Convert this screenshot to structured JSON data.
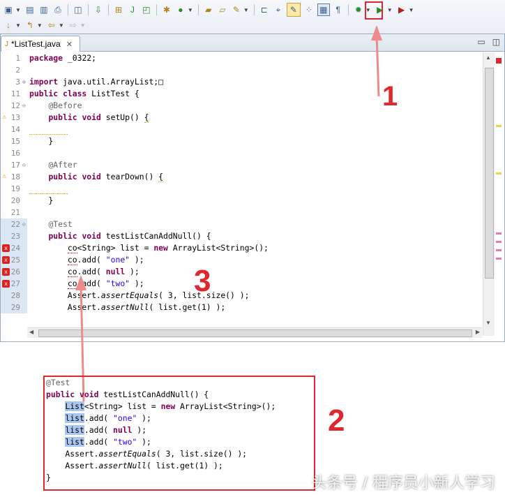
{
  "toolbar": {
    "row1_icons": [
      "new-icon",
      "save-icon",
      "save-all-icon",
      "print-icon",
      "binary-icon",
      "debug-step-icon",
      "new-package-icon",
      "new-junit-icon",
      "new-class-icon",
      "build-icon",
      "run-icon",
      "open-folder-icon",
      "open-type-icon",
      "pen-icon",
      "back-icon",
      "next-annotation-icon",
      "toggle-mark-occurrences-icon",
      "toggle-breadcrumb-icon",
      "block-selection-mode-icon",
      "show-whitespace-icon",
      "debug-run-icon",
      "run-play-icon",
      "external-tools-icon"
    ],
    "row2_icons": [
      "next-edit-icon",
      "prev-edit-icon",
      "back-arrow-icon",
      "forward-arrow-icon"
    ]
  },
  "tab": {
    "label": "*ListTest.java"
  },
  "editor": {
    "lines": [
      {
        "num": "1",
        "text": [
          {
            "t": "package",
            "c": "kw"
          },
          {
            "t": " _0322;",
            "c": ""
          }
        ]
      },
      {
        "num": "2",
        "text": []
      },
      {
        "num": "3",
        "text": [
          {
            "t": "import",
            "c": "kw"
          },
          {
            "t": " java.util.ArrayList;",
            "c": ""
          },
          {
            "t": "□",
            "c": ""
          }
        ]
      },
      {
        "num": "11",
        "text": [
          {
            "t": "public class",
            "c": "kw"
          },
          {
            "t": " ListTest {",
            "c": ""
          }
        ]
      },
      {
        "num": "12",
        "text": [
          {
            "t": "    ",
            "c": ""
          },
          {
            "t": "@Before",
            "c": "ann"
          }
        ]
      },
      {
        "num": "13",
        "text": [
          {
            "t": "    ",
            "c": ""
          },
          {
            "t": "public void",
            "c": "kw"
          },
          {
            "t": " setUp() ",
            "c": ""
          },
          {
            "t": "{",
            "c": "wsquig"
          }
        ]
      },
      {
        "num": "14",
        "text": [
          {
            "t": "        ",
            "c": "wsquig"
          }
        ]
      },
      {
        "num": "15",
        "text": [
          {
            "t": "    }",
            "c": ""
          }
        ]
      },
      {
        "num": "16",
        "text": []
      },
      {
        "num": "17",
        "text": [
          {
            "t": "    ",
            "c": ""
          },
          {
            "t": "@After",
            "c": "ann"
          }
        ]
      },
      {
        "num": "18",
        "text": [
          {
            "t": "    ",
            "c": ""
          },
          {
            "t": "public void",
            "c": "kw"
          },
          {
            "t": " tearDown() ",
            "c": ""
          },
          {
            "t": "{",
            "c": "wsquig"
          }
        ]
      },
      {
        "num": "19",
        "text": [
          {
            "t": "        ",
            "c": "wsquig"
          }
        ]
      },
      {
        "num": "20",
        "text": [
          {
            "t": "    }",
            "c": ""
          }
        ]
      },
      {
        "num": "21",
        "text": []
      },
      {
        "num": "22",
        "text": [
          {
            "t": "    ",
            "c": ""
          },
          {
            "t": "@Test",
            "c": "ann"
          }
        ]
      },
      {
        "num": "23",
        "text": [
          {
            "t": "    ",
            "c": ""
          },
          {
            "t": "public void",
            "c": "kw"
          },
          {
            "t": " testListCanAddNull() {",
            "c": ""
          }
        ]
      },
      {
        "num": "24",
        "text": [
          {
            "t": "        ",
            "c": ""
          },
          {
            "t": "co",
            "c": "squig"
          },
          {
            "t": "<String> list = ",
            "c": ""
          },
          {
            "t": "new",
            "c": "kw"
          },
          {
            "t": " ArrayList<String>();",
            "c": ""
          }
        ]
      },
      {
        "num": "25",
        "text": [
          {
            "t": "        ",
            "c": ""
          },
          {
            "t": "co",
            "c": "squig"
          },
          {
            "t": ".add( ",
            "c": ""
          },
          {
            "t": "\"one\"",
            "c": "str"
          },
          {
            "t": " );",
            "c": ""
          }
        ]
      },
      {
        "num": "26",
        "text": [
          {
            "t": "        ",
            "c": ""
          },
          {
            "t": "co",
            "c": "squig"
          },
          {
            "t": ".add( ",
            "c": ""
          },
          {
            "t": "null",
            "c": "kw"
          },
          {
            "t": " );",
            "c": ""
          }
        ]
      },
      {
        "num": "27",
        "text": [
          {
            "t": "        ",
            "c": ""
          },
          {
            "t": "co",
            "c": "squig"
          },
          {
            "t": ".add( ",
            "c": ""
          },
          {
            "t": "\"two\"",
            "c": "str"
          },
          {
            "t": " );",
            "c": ""
          }
        ]
      },
      {
        "num": "28",
        "text": [
          {
            "t": "        Assert.",
            "c": ""
          },
          {
            "t": "assertEquals",
            "c": "it"
          },
          {
            "t": "( 3, list.size() );",
            "c": ""
          }
        ]
      },
      {
        "num": "29",
        "text": [
          {
            "t": "        Assert.",
            "c": ""
          },
          {
            "t": "assertNull",
            "c": "it"
          },
          {
            "t": "( list.get(1) );",
            "c": ""
          }
        ]
      }
    ]
  },
  "snippet": {
    "lines": [
      [
        {
          "t": "@Test",
          "c": "ann"
        }
      ],
      [
        {
          "t": "public void",
          "c": "kw"
        },
        {
          "t": " testListCanAddNull() {",
          "c": ""
        }
      ],
      [
        {
          "t": "    ",
          "c": ""
        },
        {
          "t": "List",
          "c": "sel"
        },
        {
          "t": "<String> list = ",
          "c": ""
        },
        {
          "t": "new",
          "c": "kw"
        },
        {
          "t": " ArrayList<String>();",
          "c": ""
        }
      ],
      [
        {
          "t": "    ",
          "c": ""
        },
        {
          "t": "list",
          "c": "sel"
        },
        {
          "t": ".add( ",
          "c": ""
        },
        {
          "t": "\"one\"",
          "c": "str"
        },
        {
          "t": " );",
          "c": ""
        }
      ],
      [
        {
          "t": "    ",
          "c": ""
        },
        {
          "t": "list",
          "c": "sel"
        },
        {
          "t": ".add( ",
          "c": ""
        },
        {
          "t": "null",
          "c": "kw"
        },
        {
          "t": " );",
          "c": ""
        }
      ],
      [
        {
          "t": "    ",
          "c": ""
        },
        {
          "t": "list",
          "c": "sel"
        },
        {
          "t": ".add( ",
          "c": ""
        },
        {
          "t": "\"two\"",
          "c": "str"
        },
        {
          "t": " );",
          "c": ""
        }
      ],
      [
        {
          "t": "    Assert.",
          "c": ""
        },
        {
          "t": "assertEquals",
          "c": "it"
        },
        {
          "t": "( 3, list.size() );",
          "c": ""
        }
      ],
      [
        {
          "t": "    Assert.",
          "c": ""
        },
        {
          "t": "assertNull",
          "c": "it"
        },
        {
          "t": "( list.get(1) );",
          "c": ""
        }
      ],
      [
        {
          "t": "}",
          "c": ""
        }
      ]
    ]
  },
  "annotations": {
    "label1": "1",
    "label2": "2",
    "label3": "3"
  },
  "watermark": "头条号 / 程序员小新人学习",
  "colors": {
    "annotation_red": "#e0262e",
    "selection": "#a9c6ee",
    "keyword": "#7f0055",
    "string": "#2a00ff"
  }
}
